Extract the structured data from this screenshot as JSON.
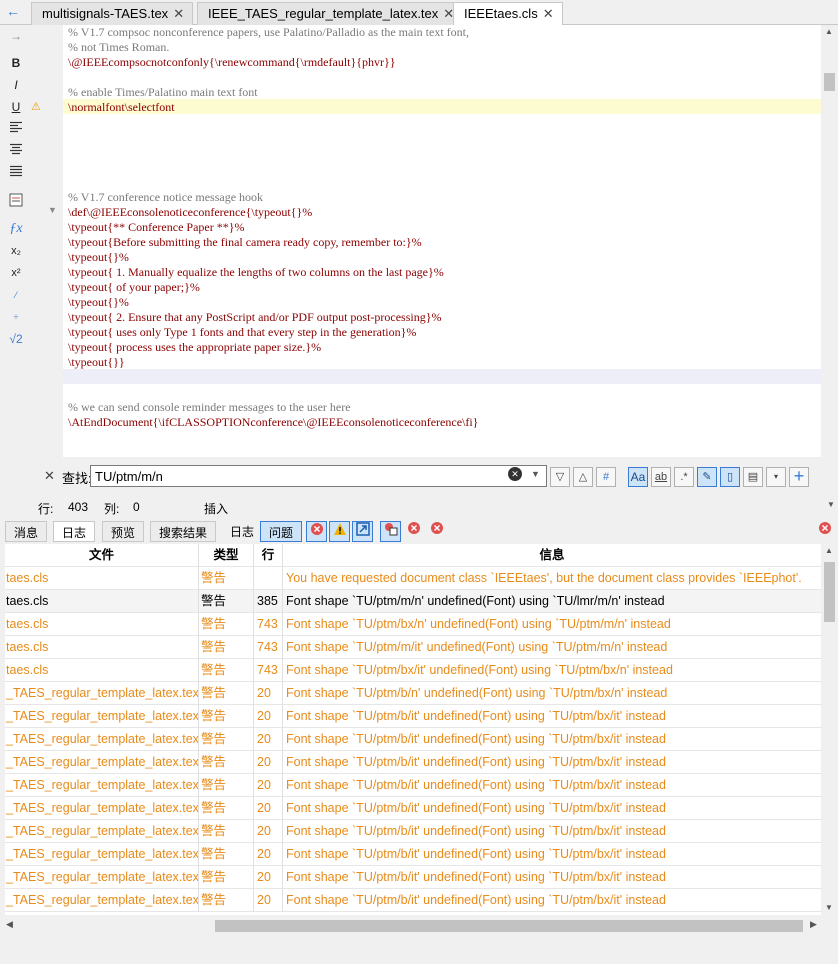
{
  "tabs": [
    {
      "label": "multisignals-TAES.tex",
      "active": false
    },
    {
      "label": "IEEE_TAES_regular_template_latex.tex",
      "active": false
    },
    {
      "label": "IEEEtaes.cls",
      "active": true
    }
  ],
  "tab_close_glyph": "✕",
  "left_toolbar": [
    "B",
    "I",
    "U"
  ],
  "code_lines": [
    {
      "text": "% V1.7 compsoc nonconference papers, use Palatino/Palladio as the main text font,",
      "kind": "comment"
    },
    {
      "text": "% not Times Roman.",
      "kind": "comment"
    },
    {
      "text": "\\@IEEEcompsocnotconfonly{\\renewcommand{\\rmdefault}{phvr}}",
      "kind": "code"
    },
    {
      "text": "",
      "kind": "code"
    },
    {
      "text": "% enable Times/Palatino main text font",
      "kind": "comment"
    },
    {
      "text": "\\normalfont\\selectfont",
      "kind": "code"
    },
    {
      "text": "",
      "kind": "code"
    },
    {
      "text": "",
      "kind": "code"
    },
    {
      "text": "",
      "kind": "code"
    },
    {
      "text": "",
      "kind": "code"
    },
    {
      "text": "",
      "kind": "code"
    },
    {
      "text": "% V1.7 conference notice message hook",
      "kind": "comment"
    },
    {
      "text": "\\def\\@IEEEconsolenoticeconference{\\typeout{}%",
      "kind": "code"
    },
    {
      "text": "\\typeout{** Conference Paper **}%",
      "kind": "code"
    },
    {
      "text": "\\typeout{Before submitting the final camera ready copy, remember to:}%",
      "kind": "code"
    },
    {
      "text": "\\typeout{}%",
      "kind": "code"
    },
    {
      "text": "\\typeout{ 1. Manually equalize the lengths of two columns on the last page}%",
      "kind": "code"
    },
    {
      "text": "\\typeout{ of your paper;}%",
      "kind": "code"
    },
    {
      "text": "\\typeout{}%",
      "kind": "code"
    },
    {
      "text": "\\typeout{ 2. Ensure that any PostScript and/or PDF output post-processing}%",
      "kind": "code"
    },
    {
      "text": "\\typeout{ uses only Type 1 fonts and that every step in the generation}%",
      "kind": "code"
    },
    {
      "text": "\\typeout{ process uses the appropriate paper size.}%",
      "kind": "code"
    },
    {
      "text": "\\typeout{}}",
      "kind": "code"
    },
    {
      "text": "",
      "kind": "code"
    },
    {
      "text": "",
      "kind": "code"
    },
    {
      "text": "% we can send console reminder messages to the user here",
      "kind": "comment"
    },
    {
      "text": "\\AtEndDocument{\\ifCLASSOPTIONconference\\@IEEEconsolenoticeconference\\fi}",
      "kind": "code"
    }
  ],
  "search": {
    "label": "查找:",
    "value": "TU/ptm/m/n"
  },
  "status": {
    "line_label": "行:",
    "line_value": "403",
    "col_label": "列:",
    "col_value": "0",
    "mode": "插入"
  },
  "panel_tabs": [
    "消息",
    "日志",
    "预览",
    "搜索结果",
    "日志",
    "问题"
  ],
  "log_table": {
    "headers": [
      "文件",
      "类型",
      "行",
      "信息"
    ],
    "rows": [
      {
        "file": "taes.cls",
        "type": "警告",
        "line": "",
        "msg": "You have requested document class `IEEEtaes', but the document class provides `IEEEphot'.",
        "style": "warn"
      },
      {
        "file": "taes.cls",
        "type": "警告",
        "line": "385",
        "msg": "Font shape `TU/ptm/m/n' undefined(Font) using `TU/lmr/m/n' instead",
        "style": "sel"
      },
      {
        "file": "taes.cls",
        "type": "警告",
        "line": "743",
        "msg": "Font shape `TU/ptm/bx/n' undefined(Font) using `TU/ptm/m/n' instead",
        "style": "warn"
      },
      {
        "file": "taes.cls",
        "type": "警告",
        "line": "743",
        "msg": "Font shape `TU/ptm/m/it' undefined(Font) using `TU/ptm/m/n' instead",
        "style": "warn"
      },
      {
        "file": "taes.cls",
        "type": "警告",
        "line": "743",
        "msg": "Font shape `TU/ptm/bx/it' undefined(Font) using `TU/ptm/bx/n' instead",
        "style": "warn"
      },
      {
        "file": "_TAES_regular_template_latex.tex",
        "type": "警告",
        "line": "20",
        "msg": "Font shape `TU/ptm/b/n' undefined(Font) using `TU/ptm/bx/n' instead",
        "style": "warn"
      },
      {
        "file": "_TAES_regular_template_latex.tex",
        "type": "警告",
        "line": "20",
        "msg": "Font shape `TU/ptm/b/it' undefined(Font) using `TU/ptm/bx/it' instead",
        "style": "warn"
      },
      {
        "file": "_TAES_regular_template_latex.tex",
        "type": "警告",
        "line": "20",
        "msg": "Font shape `TU/ptm/b/it' undefined(Font) using `TU/ptm/bx/it' instead",
        "style": "warn"
      },
      {
        "file": "_TAES_regular_template_latex.tex",
        "type": "警告",
        "line": "20",
        "msg": "Font shape `TU/ptm/b/it' undefined(Font) using `TU/ptm/bx/it' instead",
        "style": "warn"
      },
      {
        "file": "_TAES_regular_template_latex.tex",
        "type": "警告",
        "line": "20",
        "msg": "Font shape `TU/ptm/b/it' undefined(Font) using `TU/ptm/bx/it' instead",
        "style": "warn"
      },
      {
        "file": "_TAES_regular_template_latex.tex",
        "type": "警告",
        "line": "20",
        "msg": "Font shape `TU/ptm/b/it' undefined(Font) using `TU/ptm/bx/it' instead",
        "style": "warn"
      },
      {
        "file": "_TAES_regular_template_latex.tex",
        "type": "警告",
        "line": "20",
        "msg": "Font shape `TU/ptm/b/it' undefined(Font) using `TU/ptm/bx/it' instead",
        "style": "warn"
      },
      {
        "file": "_TAES_regular_template_latex.tex",
        "type": "警告",
        "line": "20",
        "msg": "Font shape `TU/ptm/b/it' undefined(Font) using `TU/ptm/bx/it' instead",
        "style": "warn"
      },
      {
        "file": "_TAES_regular_template_latex.tex",
        "type": "警告",
        "line": "20",
        "msg": "Font shape `TU/ptm/b/it' undefined(Font) using `TU/ptm/bx/it' instead",
        "style": "warn"
      },
      {
        "file": "_TAES_regular_template_latex.tex",
        "type": "警告",
        "line": "20",
        "msg": "Font shape `TU/ptm/b/it' undefined(Font) using `TU/ptm/bx/it' instead",
        "style": "warn"
      }
    ]
  },
  "colors": {
    "warning_text": "#e88b1a",
    "code_keyword": "#8b0000",
    "comment": "#7a7a7a",
    "current_line": "#fdfbd0",
    "accent": "#3a7bd5"
  }
}
